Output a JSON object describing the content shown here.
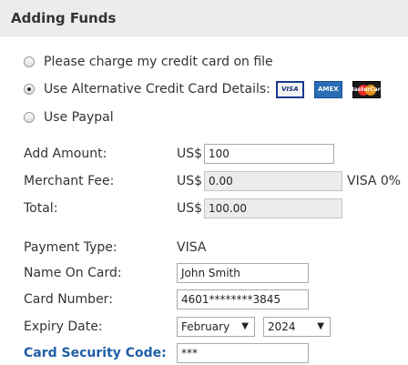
{
  "header": {
    "title": "Adding Funds"
  },
  "payment_options": [
    {
      "label": "Please charge my credit card on file",
      "checked": false
    },
    {
      "label": "Use Alternative Credit Card Details:",
      "checked": true
    },
    {
      "label": "Use Paypal",
      "checked": false
    }
  ],
  "card_logos": [
    {
      "name": "visa-logo",
      "text": "VISA"
    },
    {
      "name": "amex-logo",
      "text": "AMEX"
    },
    {
      "name": "mastercard-logo",
      "text": "MasterCard"
    }
  ],
  "amounts": {
    "currency": "US$",
    "add_amount": {
      "label": "Add Amount:",
      "value": "100"
    },
    "merchant_fee": {
      "label": "Merchant Fee:",
      "value": "0.00",
      "note": "VISA 0%"
    },
    "total": {
      "label": "Total:",
      "value": "100.00"
    }
  },
  "card_details": {
    "payment_type": {
      "label": "Payment Type:",
      "value": "VISA"
    },
    "name_on_card": {
      "label": "Name On Card:",
      "value": "John Smith"
    },
    "card_number": {
      "label": "Card Number:",
      "value": "4601********3845"
    },
    "expiry": {
      "label": "Expiry Date:",
      "month": "February",
      "year": "2024"
    },
    "security_code": {
      "label": "Card Security Code:",
      "value": "***"
    }
  },
  "colors": {
    "header_bg": "#ececec",
    "link": "#1f5fa8"
  }
}
